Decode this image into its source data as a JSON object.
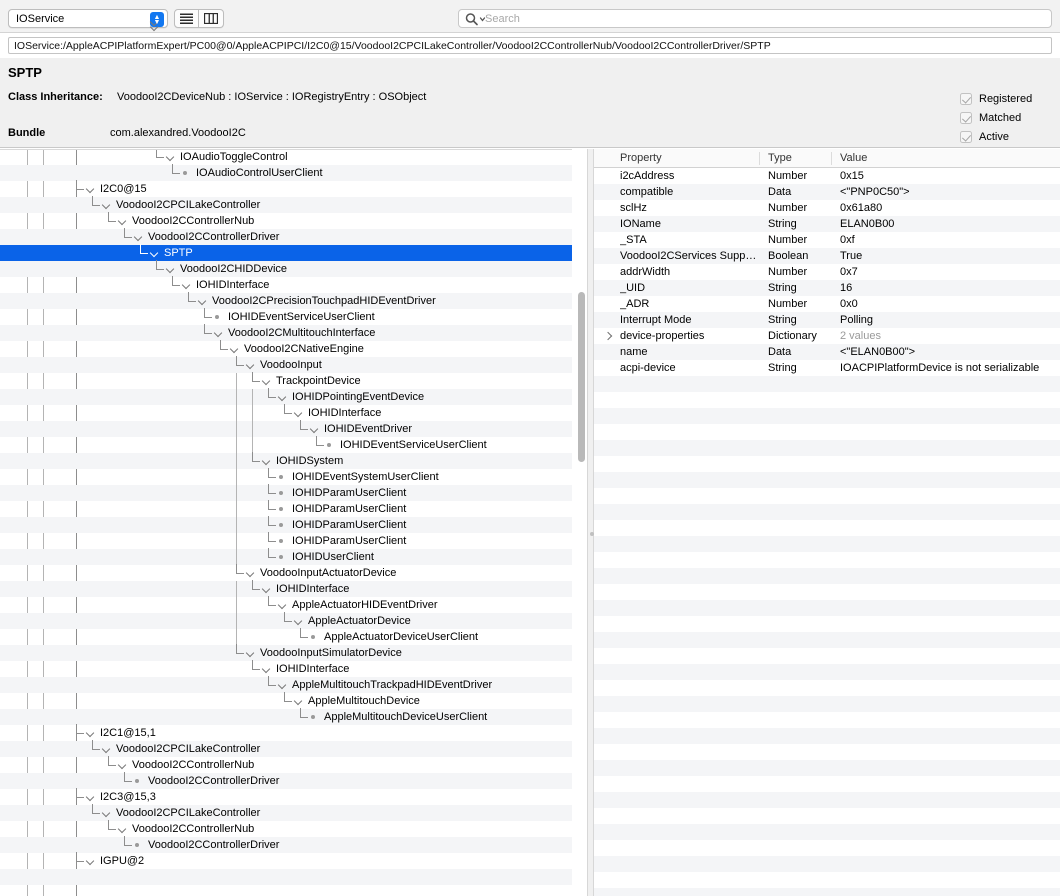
{
  "toolbar": {
    "plane_selector": {
      "value": "IOService",
      "icon": "stepper-icon"
    },
    "view_list_label": "list-view",
    "view_column_label": "column-view",
    "search": {
      "placeholder": "Search",
      "value": "",
      "icon": "search-icon"
    }
  },
  "path_bar": {
    "value": "IOService:/AppleACPIPlatformExpert/PC00@0/AppleACPIPCI/I2C0@15/VoodooI2CPCILakeController/VoodooI2CControllerNub/VoodooI2CControllerDriver/SPTP"
  },
  "info": {
    "title": "SPTP",
    "class_inheritance_label": "Class Inheritance:",
    "class_inheritance_value": "VoodooI2CDeviceNub : IOService : IORegistryEntry : OSObject",
    "bundle_label": "Bundle",
    "bundle_value": "com.alexandred.VoodooI2C",
    "flags": [
      {
        "label": "Registered",
        "checked": true
      },
      {
        "label": "Matched",
        "checked": true
      },
      {
        "label": "Active",
        "checked": true
      }
    ]
  },
  "tree": {
    "rows": [
      {
        "label": "IOAudioToggleControl",
        "indent": 9,
        "kind": "branch"
      },
      {
        "label": "IOAudioControlUserClient",
        "indent": 10,
        "kind": "leaf"
      },
      {
        "label": "I2C0@15",
        "indent": 4,
        "kind": "branch"
      },
      {
        "label": "VoodooI2CPCILakeController",
        "indent": 5,
        "kind": "branch"
      },
      {
        "label": "VoodooI2CControllerNub",
        "indent": 6,
        "kind": "branch"
      },
      {
        "label": "VoodooI2CControllerDriver",
        "indent": 7,
        "kind": "branch"
      },
      {
        "label": "SPTP",
        "indent": 8,
        "kind": "branch",
        "selected": true
      },
      {
        "label": "VoodooI2CHIDDevice",
        "indent": 9,
        "kind": "branch"
      },
      {
        "label": "IOHIDInterface",
        "indent": 10,
        "kind": "branch"
      },
      {
        "label": "VoodooI2CPrecisionTouchpadHIDEventDriver",
        "indent": 11,
        "kind": "branch"
      },
      {
        "label": "IOHIDEventServiceUserClient",
        "indent": 12,
        "kind": "leaf"
      },
      {
        "label": "VoodooI2CMultitouchInterface",
        "indent": 12,
        "kind": "branch"
      },
      {
        "label": "VoodooI2CNativeEngine",
        "indent": 13,
        "kind": "branch"
      },
      {
        "label": "VoodooInput",
        "indent": 14,
        "kind": "branch"
      },
      {
        "label": "TrackpointDevice",
        "indent": 15,
        "kind": "branch"
      },
      {
        "label": "IOHIDPointingEventDevice",
        "indent": 16,
        "kind": "branch"
      },
      {
        "label": "IOHIDInterface",
        "indent": 17,
        "kind": "branch"
      },
      {
        "label": "IOHIDEventDriver",
        "indent": 18,
        "kind": "branch"
      },
      {
        "label": "IOHIDEventServiceUserClient",
        "indent": 19,
        "kind": "leaf"
      },
      {
        "label": "IOHIDSystem",
        "indent": 15,
        "kind": "branch"
      },
      {
        "label": "IOHIDEventSystemUserClient",
        "indent": 16,
        "kind": "leaf"
      },
      {
        "label": "IOHIDParamUserClient",
        "indent": 16,
        "kind": "leaf"
      },
      {
        "label": "IOHIDParamUserClient",
        "indent": 16,
        "kind": "leaf"
      },
      {
        "label": "IOHIDParamUserClient",
        "indent": 16,
        "kind": "leaf"
      },
      {
        "label": "IOHIDParamUserClient",
        "indent": 16,
        "kind": "leaf"
      },
      {
        "label": "IOHIDUserClient",
        "indent": 16,
        "kind": "leaf"
      },
      {
        "label": "VoodooInputActuatorDevice",
        "indent": 14,
        "kind": "branch"
      },
      {
        "label": "IOHIDInterface",
        "indent": 15,
        "kind": "branch"
      },
      {
        "label": "AppleActuatorHIDEventDriver",
        "indent": 16,
        "kind": "branch"
      },
      {
        "label": "AppleActuatorDevice",
        "indent": 17,
        "kind": "branch"
      },
      {
        "label": "AppleActuatorDeviceUserClient",
        "indent": 18,
        "kind": "leaf"
      },
      {
        "label": "VoodooInputSimulatorDevice",
        "indent": 14,
        "kind": "branch"
      },
      {
        "label": "IOHIDInterface",
        "indent": 15,
        "kind": "branch"
      },
      {
        "label": "AppleMultitouchTrackpadHIDEventDriver",
        "indent": 16,
        "kind": "branch"
      },
      {
        "label": "AppleMultitouchDevice",
        "indent": 17,
        "kind": "branch"
      },
      {
        "label": "AppleMultitouchDeviceUserClient",
        "indent": 18,
        "kind": "leaf"
      },
      {
        "label": "I2C1@15,1",
        "indent": 4,
        "kind": "branch"
      },
      {
        "label": "VoodooI2CPCILakeController",
        "indent": 5,
        "kind": "branch"
      },
      {
        "label": "VoodooI2CControllerNub",
        "indent": 6,
        "kind": "branch"
      },
      {
        "label": "VoodooI2CControllerDriver",
        "indent": 7,
        "kind": "leaf"
      },
      {
        "label": "I2C3@15,3",
        "indent": 4,
        "kind": "branch"
      },
      {
        "label": "VoodooI2CPCILakeController",
        "indent": 5,
        "kind": "branch"
      },
      {
        "label": "VoodooI2CControllerNub",
        "indent": 6,
        "kind": "branch"
      },
      {
        "label": "VoodooI2CControllerDriver",
        "indent": 7,
        "kind": "leaf"
      },
      {
        "label": "IGPU@2",
        "indent": 4,
        "kind": "branch"
      }
    ]
  },
  "properties": {
    "columns": [
      "Property",
      "Type",
      "Value"
    ],
    "rows": [
      {
        "property": "i2cAddress",
        "type": "Number",
        "value": "0x15"
      },
      {
        "property": "compatible",
        "type": "Data",
        "value": "<\"PNP0C50\">"
      },
      {
        "property": "sclHz",
        "type": "Number",
        "value": "0x61a80"
      },
      {
        "property": "IOName",
        "type": "String",
        "value": "ELAN0B00"
      },
      {
        "property": "_STA",
        "type": "Number",
        "value": "0xf"
      },
      {
        "property": "VoodooI2CServices Supp…",
        "type": "Boolean",
        "value": "True"
      },
      {
        "property": "addrWidth",
        "type": "Number",
        "value": "0x7"
      },
      {
        "property": "_UID",
        "type": "String",
        "value": "16"
      },
      {
        "property": "_ADR",
        "type": "Number",
        "value": "0x0"
      },
      {
        "property": "Interrupt Mode",
        "type": "String",
        "value": "Polling"
      },
      {
        "property": "device-properties",
        "type": "Dictionary",
        "value": "2 values",
        "value_dim": true,
        "expandable": true
      },
      {
        "property": "name",
        "type": "Data",
        "value": "<\"ELAN0B00\">"
      },
      {
        "property": "acpi-device",
        "type": "String",
        "value": "IOACPIPlatformDevice is not serializable"
      }
    ]
  },
  "colors": {
    "selection_blue": "#0a63e8",
    "stepper_blue": "#1277f0",
    "stripe": "#f4f5f7",
    "chrome": "#f0f0f0"
  }
}
